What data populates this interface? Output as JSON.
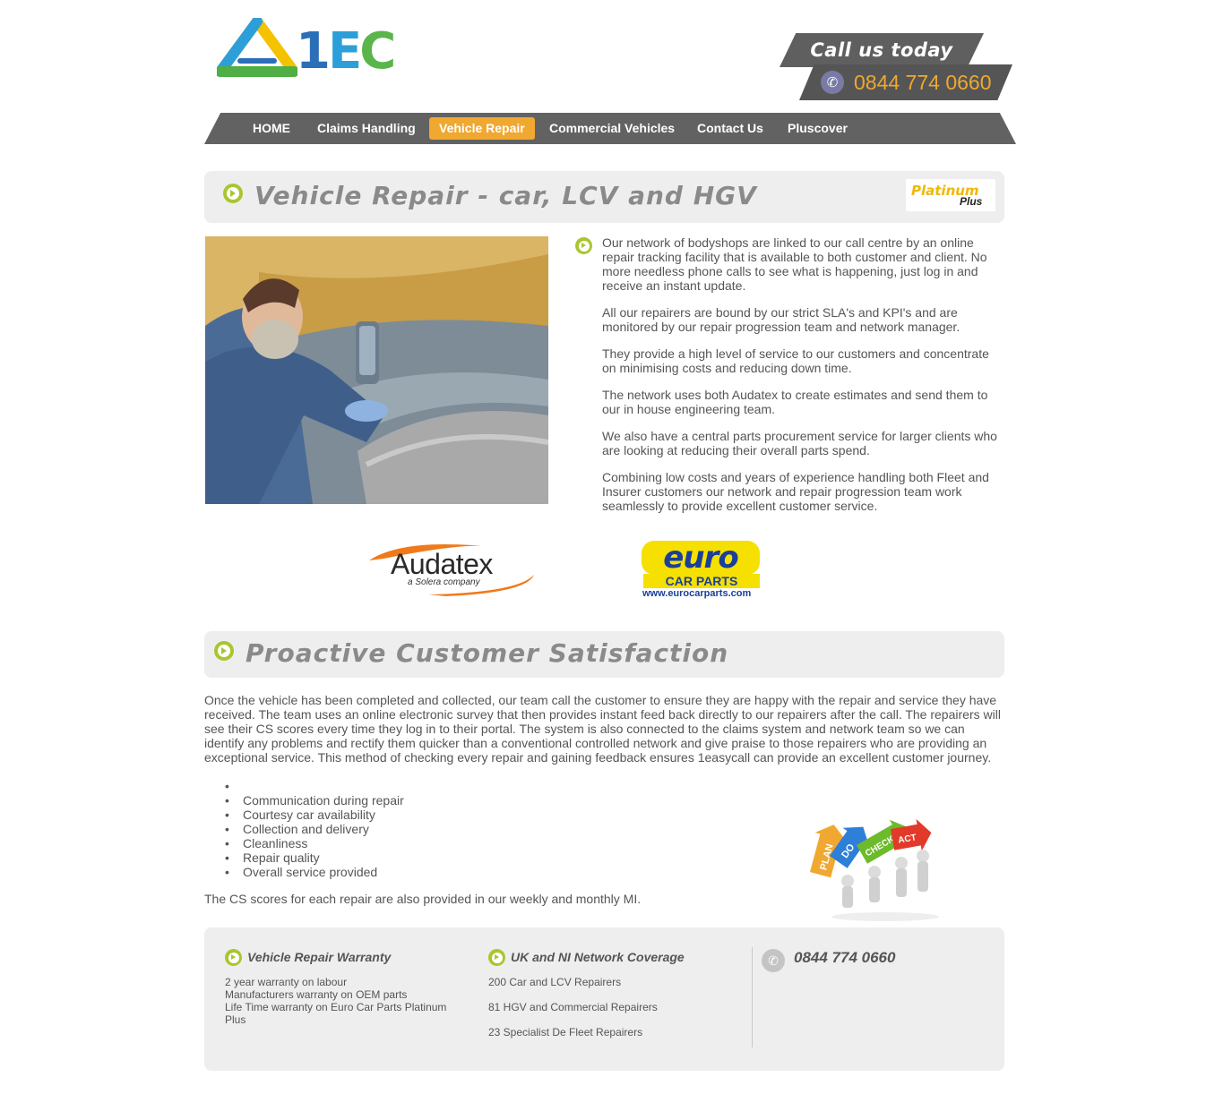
{
  "header": {
    "logo_text": "1EC",
    "call_label": "Call us today",
    "phone": "0844 774 0660"
  },
  "nav": {
    "items": [
      {
        "label": "HOME",
        "active": false
      },
      {
        "label": "Claims Handling",
        "active": false
      },
      {
        "label": "Vehicle Repair",
        "active": true
      },
      {
        "label": "Commercial Vehicles",
        "active": false
      },
      {
        "label": "Contact Us",
        "active": false
      },
      {
        "label": "Pluscover",
        "active": false
      }
    ]
  },
  "vehicle_repair": {
    "title": "Vehicle Repair - car, LCV and HGV",
    "badge_main": "Platinum",
    "badge_sub": "Plus",
    "paragraphs": [
      "Our network of bodyshops are linked to our call centre by an online repair tracking facility that is available to both customer and client. No more needless phone calls to see what is happening, just log in and receive an instant update.",
      "All our repairers are bound by our strict SLA's and KPI's and are monitored by our repair progression team and network manager.",
      "They provide a high level of service to our customers and concentrate on minimising costs and reducing down time.",
      "The network uses both Audatex to create estimates and send them to our in house engineering team.",
      "We also have a central parts procurement service for larger clients who are looking at reducing their overall parts spend.",
      "Combining low costs and years of experience handling both Fleet and Insurer customers our network and repair progression team work seamlessly to provide excellent customer service."
    ]
  },
  "partners": {
    "audatex_name": "Audatex",
    "audatex_sub": "a Solera company",
    "euro_name": "euro",
    "euro_sub": "CAR PARTS",
    "euro_url": "www.eurocarparts.com"
  },
  "proactive": {
    "title": "Proactive Customer Satisfaction",
    "intro": "Once the vehicle has been completed and collected, our team call the customer to ensure they are happy with the repair and service they have received. The team uses an online electronic survey that then provides instant feed back directly to our repairers after the call. The repairers will see their CS scores every time they log in to their portal. The system is also connected to the claims system and network team so we can identify any problems and rectify them quicker than a conventional controlled network and give praise to those repairers who are providing an exceptional service. This method of checking every repair and gaining feedback ensures 1easycall can provide an excellent customer journey.",
    "list": [
      "",
      "Communication during repair",
      "Courtesy car availability",
      "Collection and delivery",
      "Cleanliness",
      "Repair quality",
      "Overall service provided"
    ],
    "note": "The CS scores for each repair are also provided in our weekly and monthly MI.",
    "pdca_labels": [
      "PLAN",
      "DO",
      "CHECK",
      "ACT"
    ]
  },
  "footer": {
    "warranty_title": "Vehicle Repair Warranty",
    "warranty_items": [
      "2 year warranty on labour",
      "Manufacturers warranty on OEM parts",
      "Life Time warranty on Euro Car Parts Platinum Plus"
    ],
    "coverage_title": "UK and NI Network Coverage",
    "coverage_items": [
      "200 Car and LCV Repairers",
      "81 HGV and Commercial Repairers",
      "23 Specialist De Fleet Repairers"
    ],
    "phone": "0844 774 0660"
  },
  "colors": {
    "accent_orange": "#f0a830",
    "accent_green": "#a8c630",
    "nav_grey": "#626262",
    "panel_grey": "#eeeeee"
  },
  "icons": [
    "phone-icon",
    "arrow-circle-icon"
  ]
}
